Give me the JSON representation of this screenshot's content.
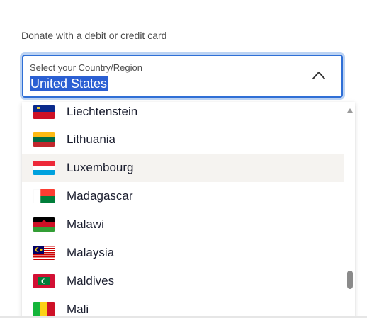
{
  "form": {
    "heading": "Donate with a debit or credit card"
  },
  "select": {
    "label": "Select your Country/Region",
    "value": "United States",
    "expanded": true,
    "accent_color": "#2f6fd6"
  },
  "dropdown": {
    "options": [
      {
        "label": "Liechtenstein",
        "flag": "flag-liechtenstein-icon"
      },
      {
        "label": "Lithuania",
        "flag": "flag-lithuania-icon"
      },
      {
        "label": "Luxembourg",
        "flag": "flag-luxembourg-icon",
        "highlighted": true
      },
      {
        "label": "Madagascar",
        "flag": "flag-madagascar-icon"
      },
      {
        "label": "Malawi",
        "flag": "flag-malawi-icon"
      },
      {
        "label": "Malaysia",
        "flag": "flag-malaysia-icon"
      },
      {
        "label": "Maldives",
        "flag": "flag-maldives-icon"
      },
      {
        "label": "Mali",
        "flag": "flag-mali-icon"
      }
    ]
  }
}
